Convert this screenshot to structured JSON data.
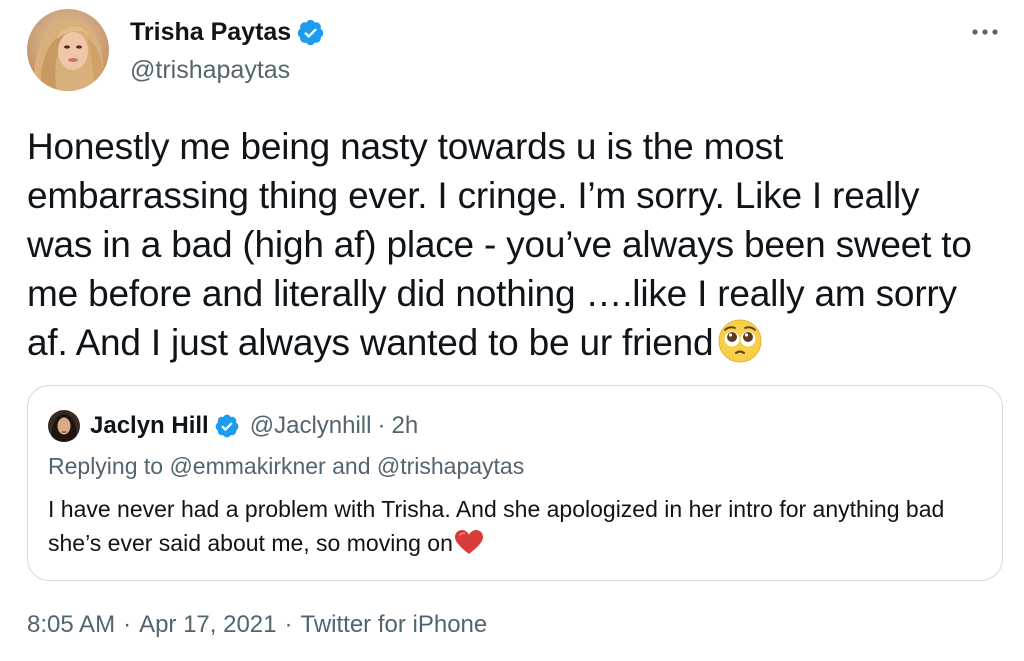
{
  "author": {
    "display_name": "Trisha Paytas",
    "handle": "@trishapaytas",
    "verified_icon": "verified-badge-icon",
    "avatar_icon": "avatar-photo"
  },
  "menu_icon": "more-options-icon",
  "tweet": {
    "text": "Honestly me being nasty towards u is the most embarrassing thing ever. I cringe. I’m sorry. Like I really was in a bad (high af) place - you’ve always been sweet to me before and literally did nothing ….like I really am sorry af. And I just always wanted to be ur friend",
    "emoji": "pleading-face-emoji"
  },
  "quote": {
    "display_name": "Jaclyn Hill",
    "handle": "@Jaclynhill",
    "separator": "·",
    "time": "2h",
    "replying_to": "Replying to @emmakirkner and @trishapaytas",
    "text": "I have never had a problem with Trisha. And she apologized in her intro for anything bad she’s ever said about me, so moving on",
    "emoji": "red-heart-emoji"
  },
  "meta": {
    "time": "8:05 AM",
    "date": "Apr 17, 2021",
    "source": "Twitter for iPhone",
    "separator": "·"
  },
  "colors": {
    "text": "#0f1419",
    "secondary": "#536471",
    "verified": "#1d9bf0",
    "border": "#cfd9de"
  }
}
